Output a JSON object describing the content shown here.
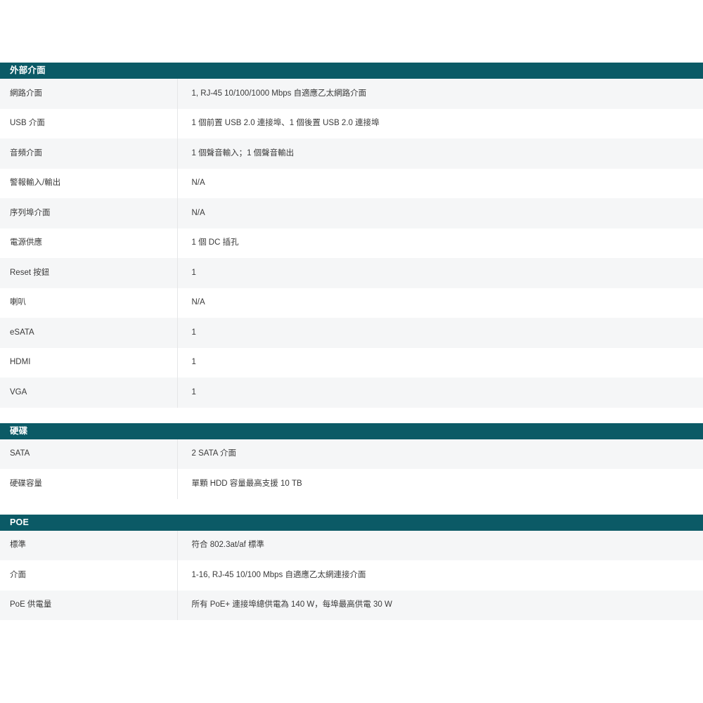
{
  "page": {
    "background_color": "#ffffff",
    "accent_color": "#0b5a66",
    "row_alt_color": "#f5f6f7",
    "divider_color": "#e6e7e8",
    "text_color": "#333333"
  },
  "sections": [
    {
      "title": "外部介面",
      "rows": [
        {
          "label": "網路介面",
          "value": "1, RJ-45 10/100/1000 Mbps 自適應乙太網路介面"
        },
        {
          "label": "USB 介面",
          "value": "1 個前置 USB 2.0 連接埠、1 個後置 USB 2.0 連接埠"
        },
        {
          "label": "音頻介面",
          "value": "1 個聲音輸入；1 個聲音輸出"
        },
        {
          "label": "警報輸入/輸出",
          "value": "N/A"
        },
        {
          "label": "序列埠介面",
          "value": "N/A"
        },
        {
          "label": "電源供應",
          "value": "1 個 DC 插孔"
        },
        {
          "label": "Reset 按鈕",
          "value": "1"
        },
        {
          "label": "喇叭",
          "value": "N/A"
        },
        {
          "label": "eSATA",
          "value": "1"
        },
        {
          "label": "HDMI",
          "value": "1"
        },
        {
          "label": "VGA",
          "value": "1"
        }
      ]
    },
    {
      "title": "硬碟",
      "rows": [
        {
          "label": "SATA",
          "value": "2 SATA 介面"
        },
        {
          "label": "硬碟容量",
          "value": "單顆 HDD 容量最高支援 10 TB"
        }
      ]
    },
    {
      "title": "POE",
      "rows": [
        {
          "label": "標準",
          "value": "符合 802.3at/af 標準"
        },
        {
          "label": "介面",
          "value": "1-16, RJ-45 10/100 Mbps 自適應乙太網連接介面"
        },
        {
          "label": "PoE 供電量",
          "value": "所有 PoE+ 連接埠總供電為 140 W，每埠最高供電 30 W"
        }
      ]
    }
  ]
}
